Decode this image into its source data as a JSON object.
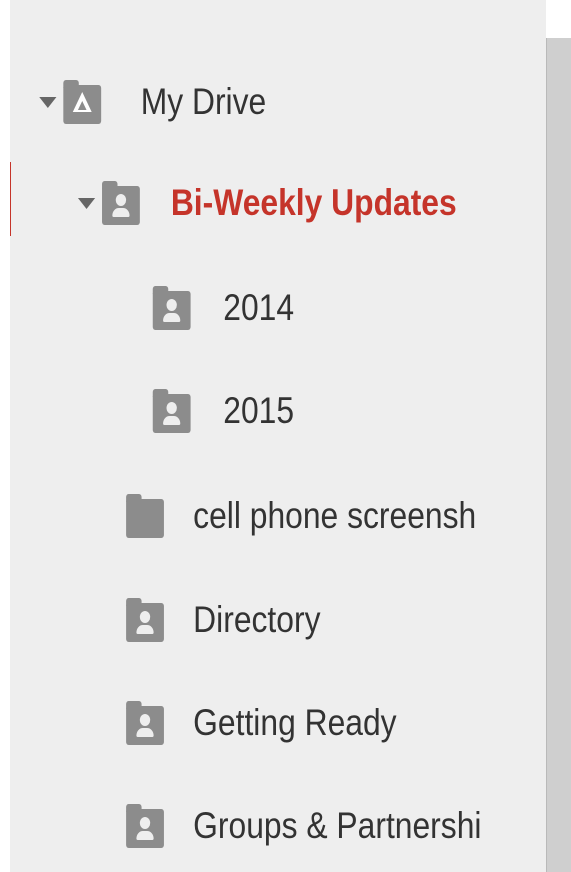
{
  "tree": {
    "my_drive": {
      "label": "My Drive",
      "icon": "drive-folder-icon",
      "expanded": true
    },
    "bi_weekly": {
      "label": "Bi-Weekly Updates",
      "icon": "shared-folder-icon",
      "expanded": true,
      "active": true
    },
    "y2014": {
      "label": "2014",
      "icon": "shared-folder-icon"
    },
    "y2015": {
      "label": "2015",
      "icon": "shared-folder-icon"
    },
    "cell": {
      "label": "cell phone screensh",
      "icon": "folder-icon"
    },
    "directory": {
      "label": "Directory",
      "icon": "shared-folder-icon"
    },
    "getting_ready": {
      "label": "Getting Ready",
      "icon": "shared-folder-icon"
    },
    "groups": {
      "label": "Groups & Partnershi",
      "icon": "shared-folder-icon"
    }
  },
  "colors": {
    "active": "#c5342a",
    "text": "#333333",
    "icon": "#8c8c8c",
    "panel_bg": "#eeeeee"
  }
}
